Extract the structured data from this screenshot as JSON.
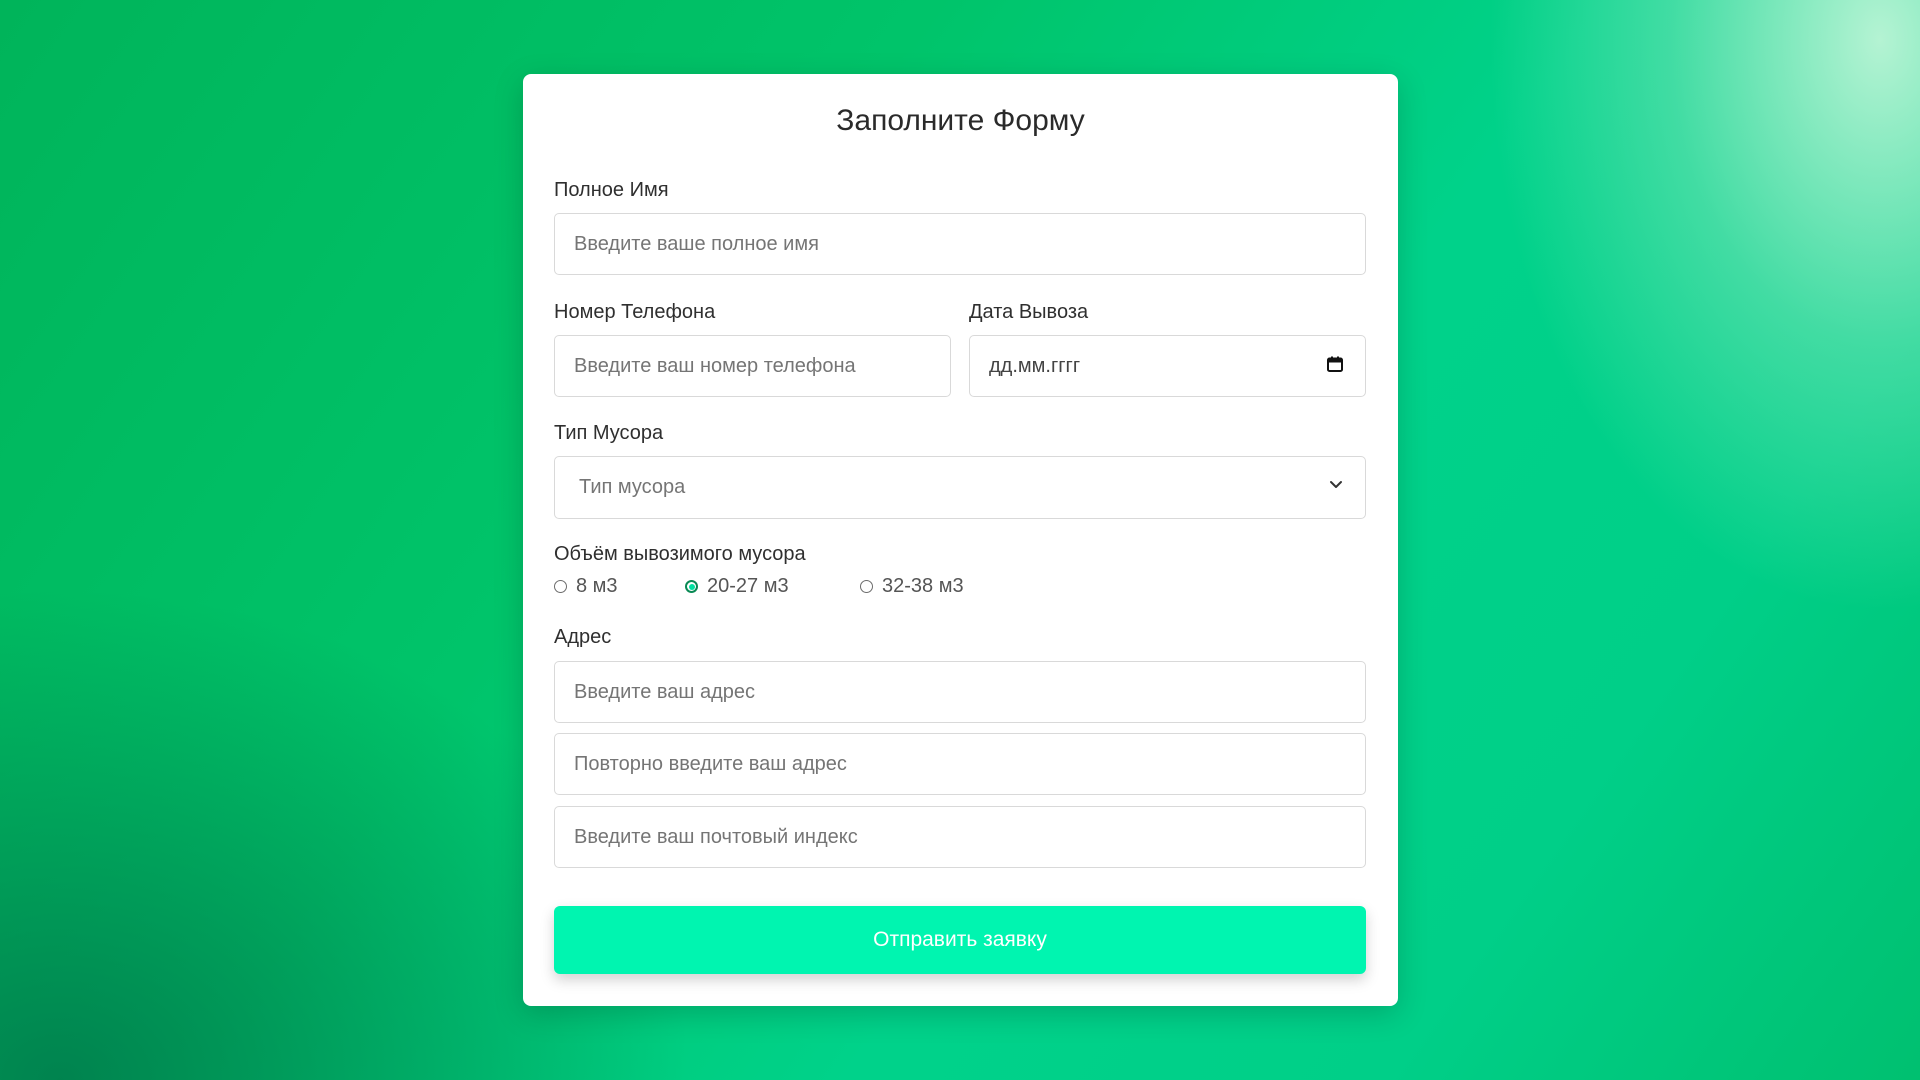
{
  "form": {
    "title": "Заполните Форму",
    "full_name": {
      "label": "Полное Имя",
      "placeholder": "Введите ваше полное имя"
    },
    "phone": {
      "label": "Номер Телефона",
      "placeholder": "Введите ваш номер телефона"
    },
    "pickup_date": {
      "label": "Дата Вывоза",
      "placeholder": "дд.мм.гггг",
      "icon": "calendar-icon"
    },
    "waste_type": {
      "label": "Тип Мусора",
      "selected": "Тип мусора",
      "icon": "chevron-down-icon"
    },
    "volume": {
      "label": "Объём вывозимого мусора",
      "options": [
        {
          "label": "8 м3",
          "checked": false
        },
        {
          "label": "20-27 м3",
          "checked": true
        },
        {
          "label": "32-38 м3",
          "checked": false
        }
      ]
    },
    "address": {
      "label": "Адрес",
      "address_placeholder": "Введите ваш адрес",
      "repeat_placeholder": "Повторно введите ваш адрес",
      "postal_placeholder": "Введите ваш почтовый индекс"
    },
    "submit_label": "Отправить заявку"
  },
  "colors": {
    "accent": "#00f5b0",
    "radio_checked": "#00e0a0",
    "background_green": "#00c46a"
  }
}
